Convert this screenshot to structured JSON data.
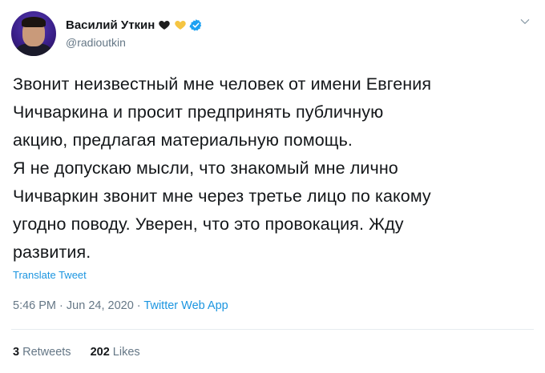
{
  "user": {
    "display_name": "Василий Уткин",
    "handle": "@radioutkin",
    "heart_colors": [
      "#1d1d1d",
      "#f5c542"
    ]
  },
  "tweet": {
    "text": "Звонит неизвестный мне человек от имени Евгения\nЧичваркина и просит предпринять публичную\nакцию, предлагая материальную помощь.\nЯ не допускаю мысли, что знакомый мне лично\nЧичваркин звонит мне через третье лицо по какому\nугодно поводу. Уверен, что это провокация. Жду\nразвития.",
    "translate_label": "Translate Tweet",
    "time": "5:46 PM",
    "separator": "·",
    "date": "Jun 24, 2020",
    "source": "Twitter Web App"
  },
  "stats": {
    "retweets_count": "3",
    "retweets_label": "Retweets",
    "likes_count": "202",
    "likes_label": "Likes"
  },
  "icons": {
    "verified": "verified-badge-icon",
    "menu": "chevron-down-icon"
  },
  "colors": {
    "link": "#1b95e0",
    "muted": "#657786",
    "text": "#14171a"
  }
}
